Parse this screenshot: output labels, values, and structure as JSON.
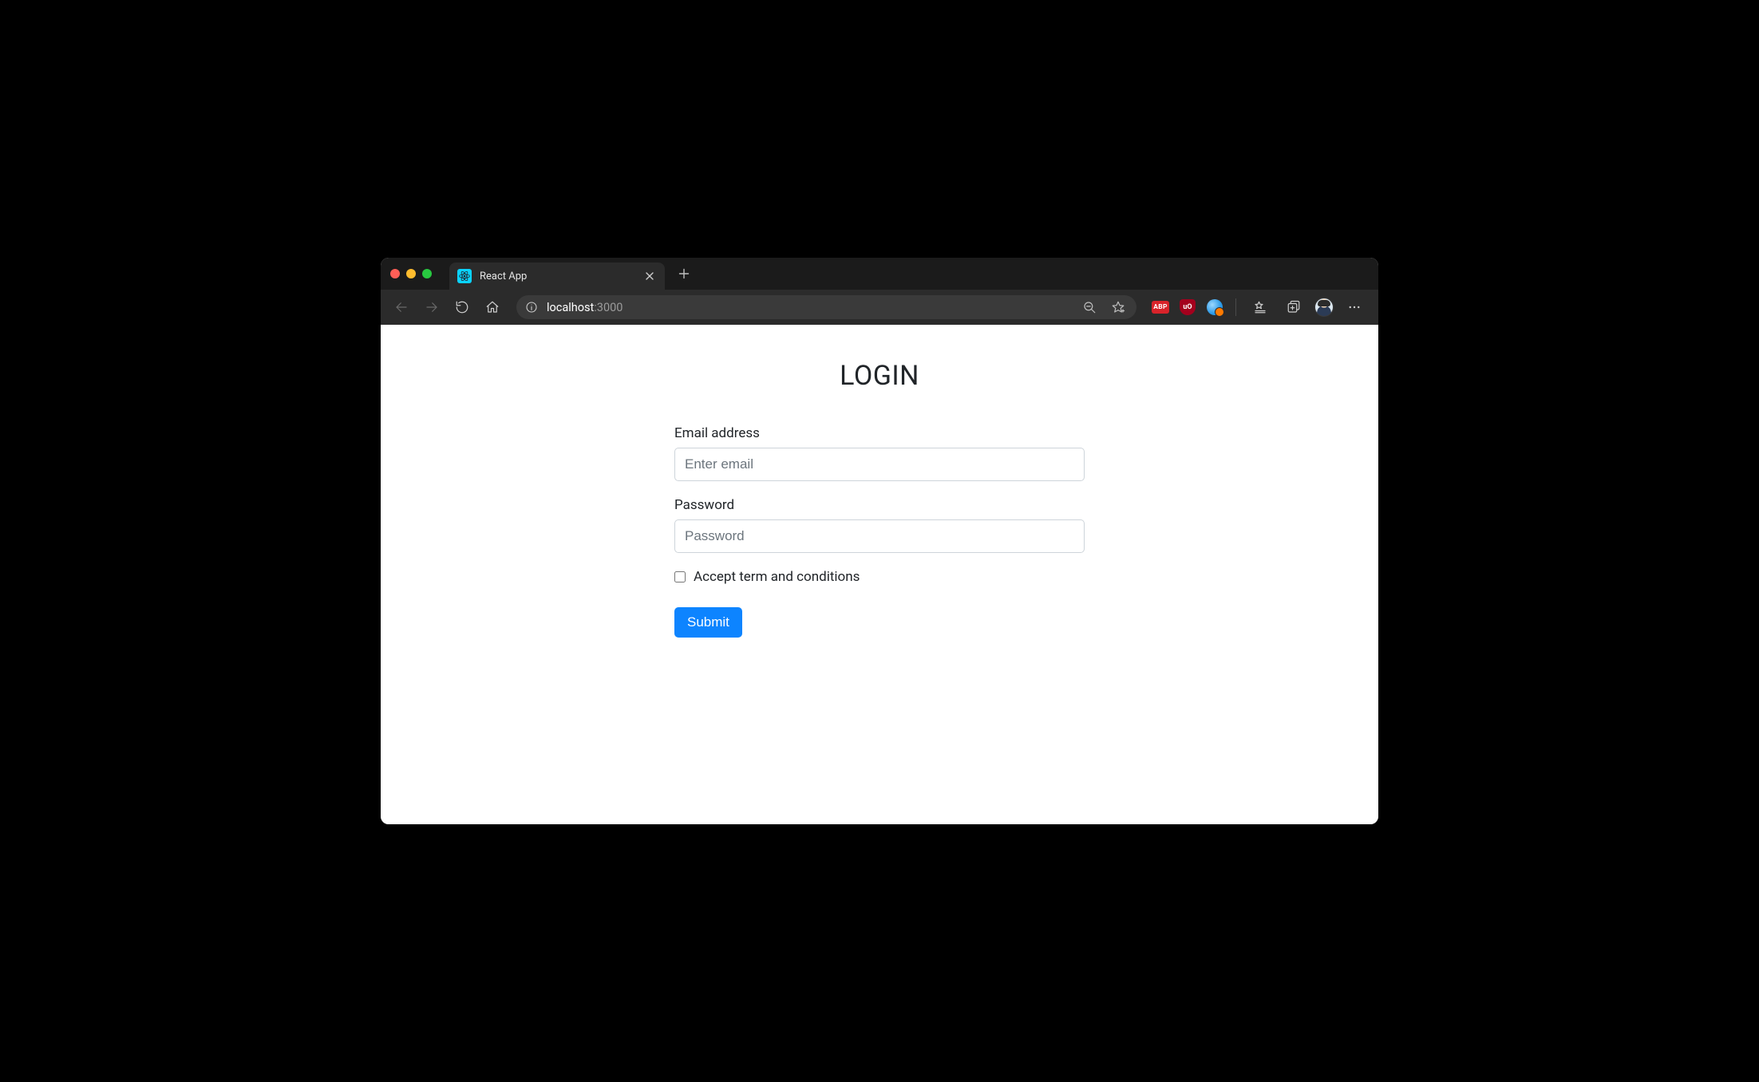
{
  "browser": {
    "tab": {
      "title": "React App"
    },
    "address": {
      "host": "localhost",
      "port": ":3000"
    },
    "extensions": {
      "abp_label": "ABP",
      "ub_label": "uO"
    }
  },
  "page": {
    "title": "LOGIN",
    "email": {
      "label": "Email address",
      "placeholder": "Enter email",
      "value": ""
    },
    "password": {
      "label": "Password",
      "placeholder": "Password",
      "value": ""
    },
    "terms": {
      "label": "Accept term and conditions",
      "checked": false
    },
    "submit_label": "Submit"
  }
}
